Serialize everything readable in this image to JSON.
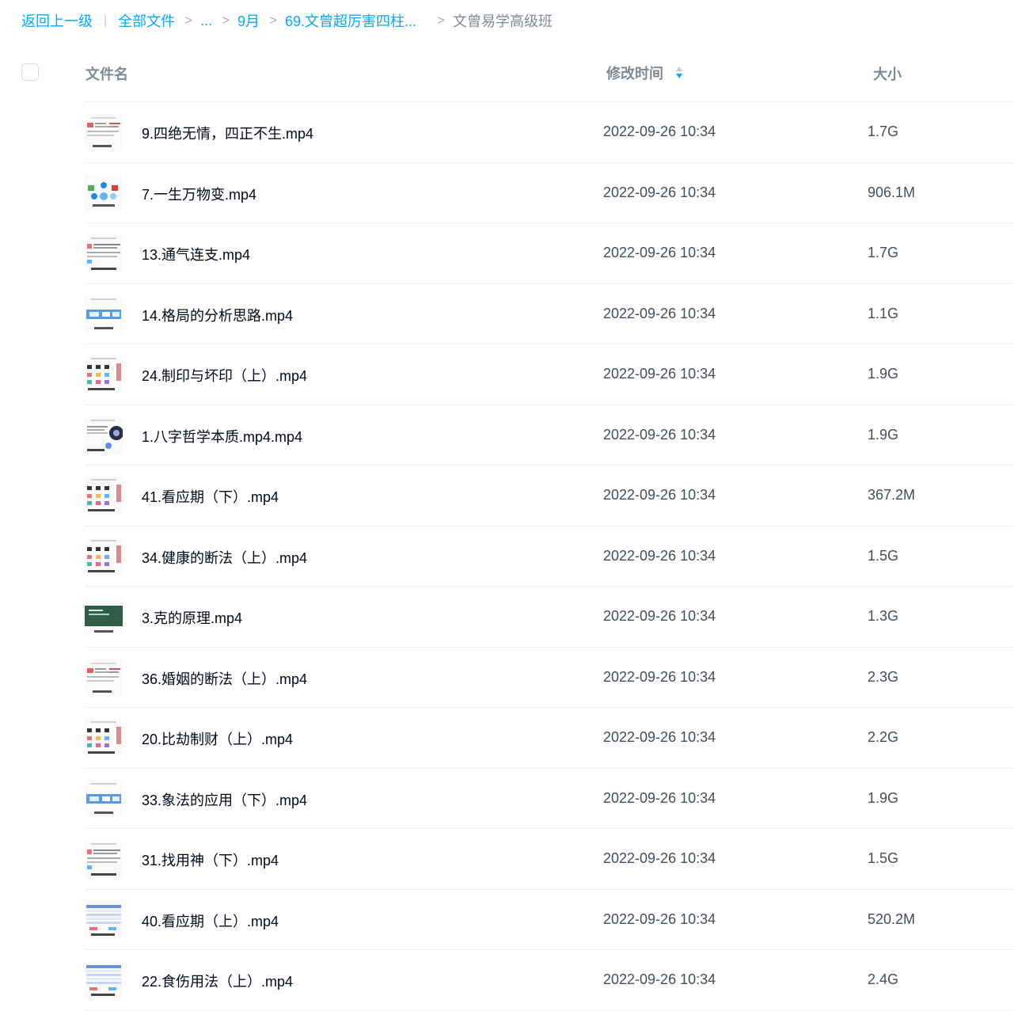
{
  "breadcrumb": {
    "back": "返回上一级",
    "divider": "|",
    "sep": ">",
    "all_files": "全部文件",
    "ellipsis": "...",
    "month": "9月",
    "folder": "69.文曾超厉害四柱...",
    "current": "文曾易学高级班"
  },
  "header": {
    "name": "文件名",
    "time": "修改时间",
    "size": "大小"
  },
  "files": [
    {
      "name": "9.四绝无情，四正不生.mp4",
      "time": "2022-09-26 10:34",
      "size": "1.7G",
      "thumb": "red-dot"
    },
    {
      "name": "7.一生万物变.mp4",
      "time": "2022-09-26 10:34",
      "size": "906.1M",
      "thumb": "shapes"
    },
    {
      "name": "13.通气连支.mp4",
      "time": "2022-09-26 10:34",
      "size": "1.7G",
      "thumb": "text"
    },
    {
      "name": "14.格局的分析思路.mp4",
      "time": "2022-09-26 10:34",
      "size": "1.1G",
      "thumb": "blue-banner"
    },
    {
      "name": "24.制印与坏印（上）.mp4",
      "time": "2022-09-26 10:34",
      "size": "1.9G",
      "thumb": "grid"
    },
    {
      "name": "1.八字哲学本质.mp4.mp4",
      "time": "2022-09-26 10:34",
      "size": "1.9G",
      "thumb": "circle"
    },
    {
      "name": "41.看应期（下）.mp4",
      "time": "2022-09-26 10:34",
      "size": "367.2M",
      "thumb": "grid"
    },
    {
      "name": "34.健康的断法（上）.mp4",
      "time": "2022-09-26 10:34",
      "size": "1.5G",
      "thumb": "grid"
    },
    {
      "name": "3.克的原理.mp4",
      "time": "2022-09-26 10:34",
      "size": "1.3G",
      "thumb": "green"
    },
    {
      "name": "36.婚姻的断法（上）.mp4",
      "time": "2022-09-26 10:34",
      "size": "2.3G",
      "thumb": "red-dot"
    },
    {
      "name": "20.比劫制财（上）.mp4",
      "time": "2022-09-26 10:34",
      "size": "2.2G",
      "thumb": "grid"
    },
    {
      "name": "33.象法的应用（下）.mp4",
      "time": "2022-09-26 10:34",
      "size": "1.9G",
      "thumb": "blue-banner"
    },
    {
      "name": "31.找用神（下）.mp4",
      "time": "2022-09-26 10:34",
      "size": "1.5G",
      "thumb": "text"
    },
    {
      "name": "40.看应期（上）.mp4",
      "time": "2022-09-26 10:34",
      "size": "520.2M",
      "thumb": "table"
    },
    {
      "name": "22.食伤用法（上）.mp4",
      "time": "2022-09-26 10:34",
      "size": "2.4G",
      "thumb": "table"
    }
  ],
  "colors": {
    "link": "#06a7ff",
    "text": "#03081a",
    "muted": "#818999",
    "sort_up": "#c4cbd7",
    "sort_down": "#06a7ff"
  },
  "icons": {
    "sort": "sort-arrows-icon",
    "thumbnail": "video-thumbnail"
  }
}
